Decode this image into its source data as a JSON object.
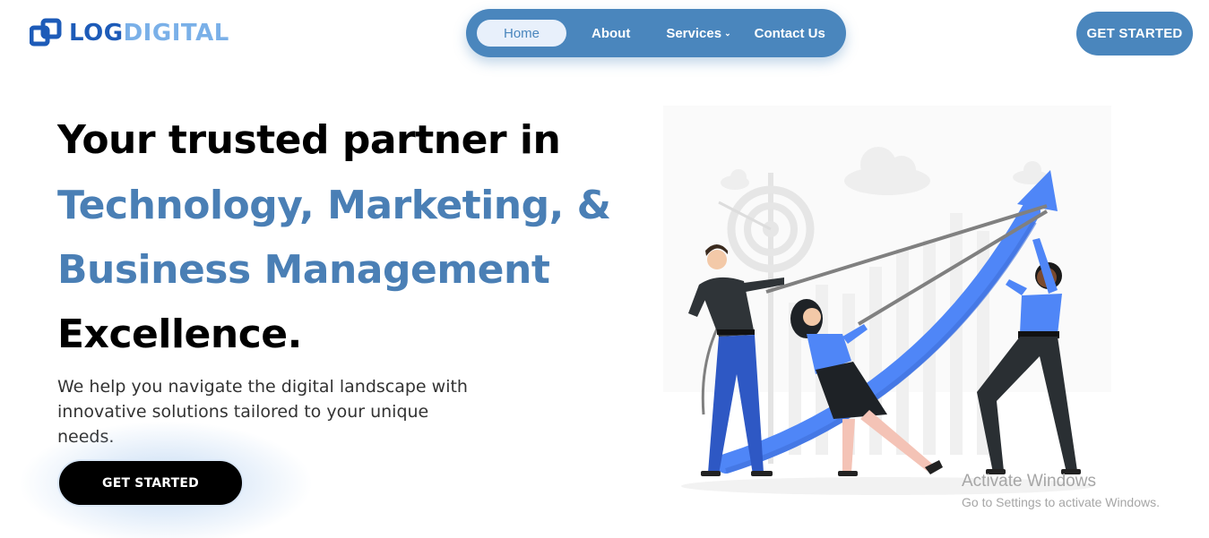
{
  "brand": {
    "part1": "LOG",
    "part2": "DIGITAL"
  },
  "nav": {
    "home": "Home",
    "about": "About",
    "services": "Services",
    "contact": "Contact Us"
  },
  "header": {
    "cta_label": "GET STARTED"
  },
  "hero": {
    "line1": "Your trusted partner in",
    "line2": "Technology, Marketing, &",
    "line3": "Business Management",
    "line4": "Excellence.",
    "subtitle": "We help you navigate the digital landscape with innovative solutions tailored to your unique needs.",
    "cta_label": "GET STARTED"
  },
  "watermark": {
    "title": "Activate Windows",
    "subtitle": "Go to Settings to activate Windows."
  },
  "colors": {
    "accent": "#4a86bd",
    "brand_dark": "#1d5bb8",
    "brand_light": "#7ab0e8",
    "arrow": "#4f86f7"
  },
  "icons": {
    "nav_services": "chevron-down-icon"
  }
}
